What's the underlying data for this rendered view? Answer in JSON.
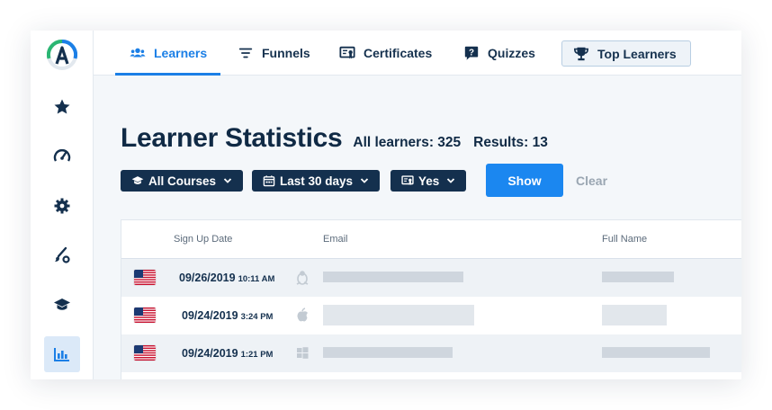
{
  "nav": {
    "tabs": [
      {
        "label": "Learners",
        "icon": "users-icon"
      },
      {
        "label": "Funnels",
        "icon": "filter-icon"
      },
      {
        "label": "Certificates",
        "icon": "certificate-icon"
      },
      {
        "label": "Quizzes",
        "icon": "question-icon"
      },
      {
        "label": "Top Learners",
        "icon": "trophy-icon"
      }
    ]
  },
  "sidebar": {
    "items": [
      {
        "icon": "star-icon"
      },
      {
        "icon": "speedometer-icon"
      },
      {
        "icon": "gear-icon"
      },
      {
        "icon": "brush-settings-icon"
      },
      {
        "icon": "graduation-cap-icon"
      },
      {
        "icon": "bar-chart-icon",
        "active": true
      }
    ]
  },
  "header": {
    "title": "Learner Statistics",
    "all_learners": "All learners: 325",
    "results": "Results: 13"
  },
  "filters": {
    "courses": "All Courses",
    "period": "Last 30 days",
    "certificate": "Yes",
    "show": "Show",
    "clear": "Clear"
  },
  "table": {
    "columns": [
      "Sign Up Date",
      "Email",
      "Full Name"
    ],
    "rows": [
      {
        "date": "09/26/2019",
        "time": "10:11 AM",
        "os": "linux-icon"
      },
      {
        "date": "09/24/2019",
        "time": "3:24 PM",
        "os": "apple-icon"
      },
      {
        "date": "09/24/2019",
        "time": "1:21 PM",
        "os": "windows-icon"
      }
    ]
  },
  "colors": {
    "accent": "#1b7fe6",
    "dark": "#14304e",
    "logo_green": "#2bb673"
  }
}
